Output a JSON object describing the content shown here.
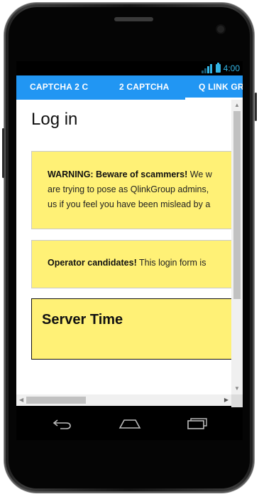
{
  "status_bar": {
    "time": "4:00",
    "icons": [
      "signal-icon",
      "battery-icon"
    ]
  },
  "tabs": [
    {
      "label": "CAPTCHA 2 C",
      "active": false
    },
    {
      "label": "2 CAPTCHA",
      "active": false
    },
    {
      "label": "Q LINK GR",
      "active": true
    }
  ],
  "page": {
    "title": "Log in"
  },
  "warning_box": {
    "line1_bold": "WARNING: Beware of scammers!",
    "line1_rest": " We w",
    "line2": "are trying to pose as QlinkGroup admins,",
    "line3": "us if you feel you have been mislead by a"
  },
  "operator_box": {
    "bold": "Operator candidates!",
    "rest": " This login form is"
  },
  "server_time_box": {
    "title": "Server Time"
  },
  "scrollbars": {
    "up_arrow": "▲",
    "down_arrow": "▼",
    "left_arrow": "◀",
    "right_arrow": "▶"
  },
  "colors": {
    "tab_bar": "#2196f3",
    "box_fill": "#fff176",
    "status_accent": "#33b5e5"
  },
  "nav_icons": [
    "back-icon",
    "home-icon",
    "recent-apps-icon"
  ]
}
